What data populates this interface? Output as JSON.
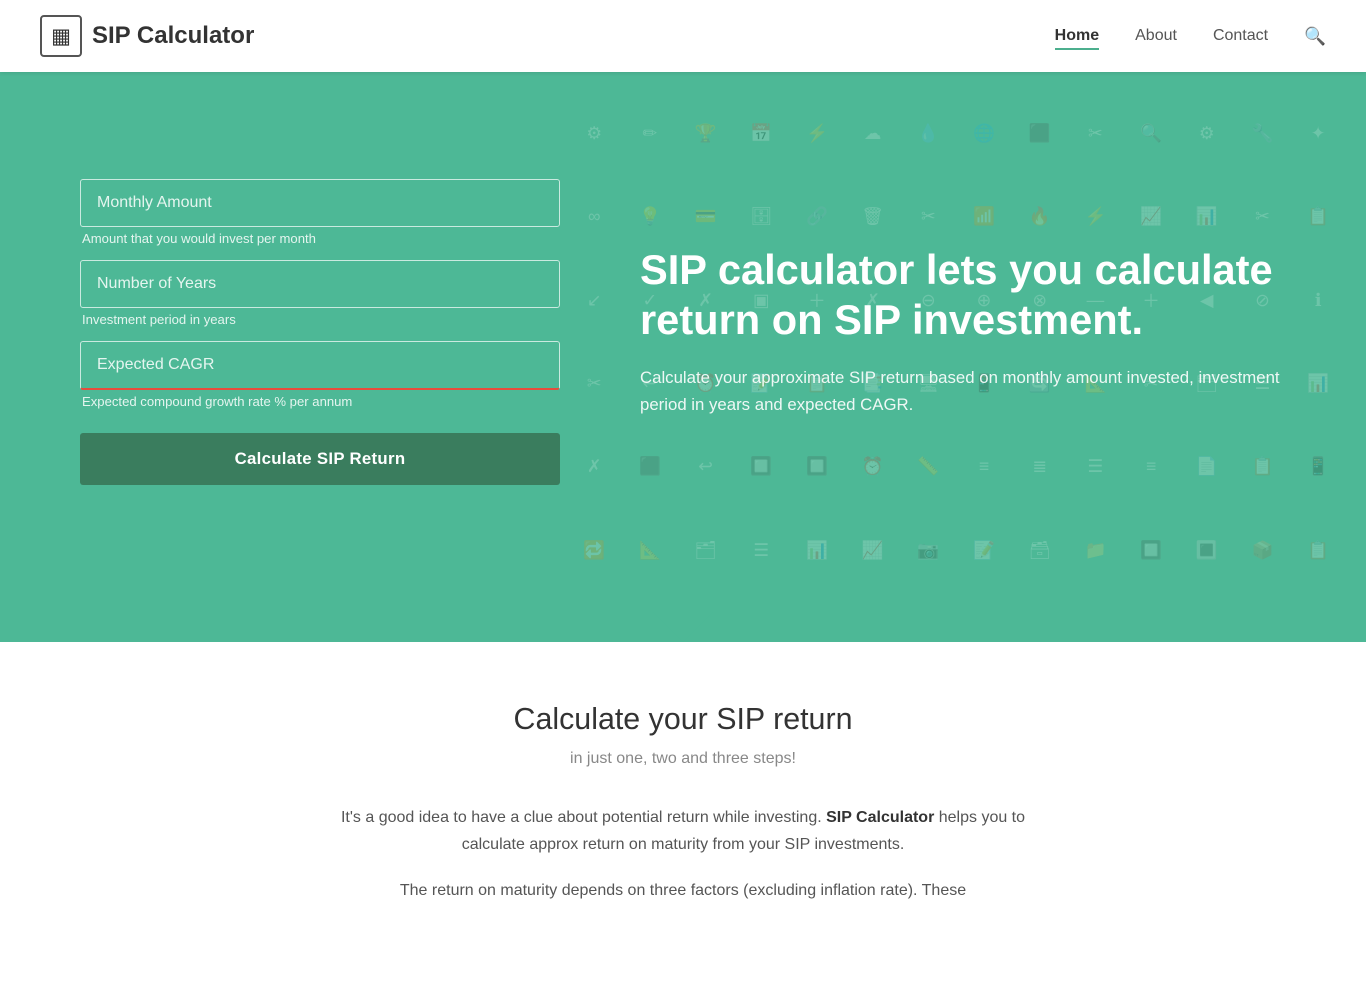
{
  "navbar": {
    "brand": "SIP Calculator",
    "logo_icon": "▦",
    "nav": [
      {
        "label": "Home",
        "active": true
      },
      {
        "label": "About",
        "active": false
      },
      {
        "label": "Contact",
        "active": false
      }
    ],
    "search_icon": "🔍"
  },
  "hero": {
    "heading": "SIP calculator lets you calculate return on SIP investment.",
    "description": "Calculate your approximate SIP return based on monthly amount invested, investment period in years and expected CAGR.",
    "form": {
      "monthly_amount_placeholder": "Monthly Amount",
      "monthly_amount_hint": "Amount that you would invest per month",
      "years_placeholder": "Number of Years",
      "years_hint": "Investment period in years",
      "cagr_placeholder": "Expected CAGR",
      "cagr_hint": "Expected compound growth rate % per annum",
      "button_label": "Calculate SIP Return"
    }
  },
  "content": {
    "heading": "Calculate your SIP return",
    "subtitle": "in just one, two and three steps!",
    "para1_prefix": "It's a good idea to have a clue about potential return while investing. ",
    "para1_bold": "SIP Calculator",
    "para1_suffix": " helps you to calculate approx return on maturity from your SIP investments.",
    "para2": "The return on maturity depends on three factors (excluding inflation rate). These"
  },
  "bg_icons": [
    "⚙",
    "✏",
    "🏆",
    "📅",
    "⚡",
    "☁",
    "💧",
    "🌐",
    "⬛",
    "📷",
    "∞",
    "💡",
    "💳",
    "🗄",
    "🔗",
    "🗑",
    "✂",
    "📶",
    "🔥",
    "⚡",
    "📈",
    "📊",
    "✂",
    "📋",
    "☰",
    "📱",
    "🔲",
    "🖊",
    "🔍",
    "⚙",
    "🔧",
    "☰",
    "🔀",
    "↩",
    "⏰",
    "📝",
    "📋",
    "📑",
    "🖥",
    "📱",
    "🔄",
    "📐",
    "✂",
    "🗂",
    "☰",
    "📊",
    "📈"
  ]
}
